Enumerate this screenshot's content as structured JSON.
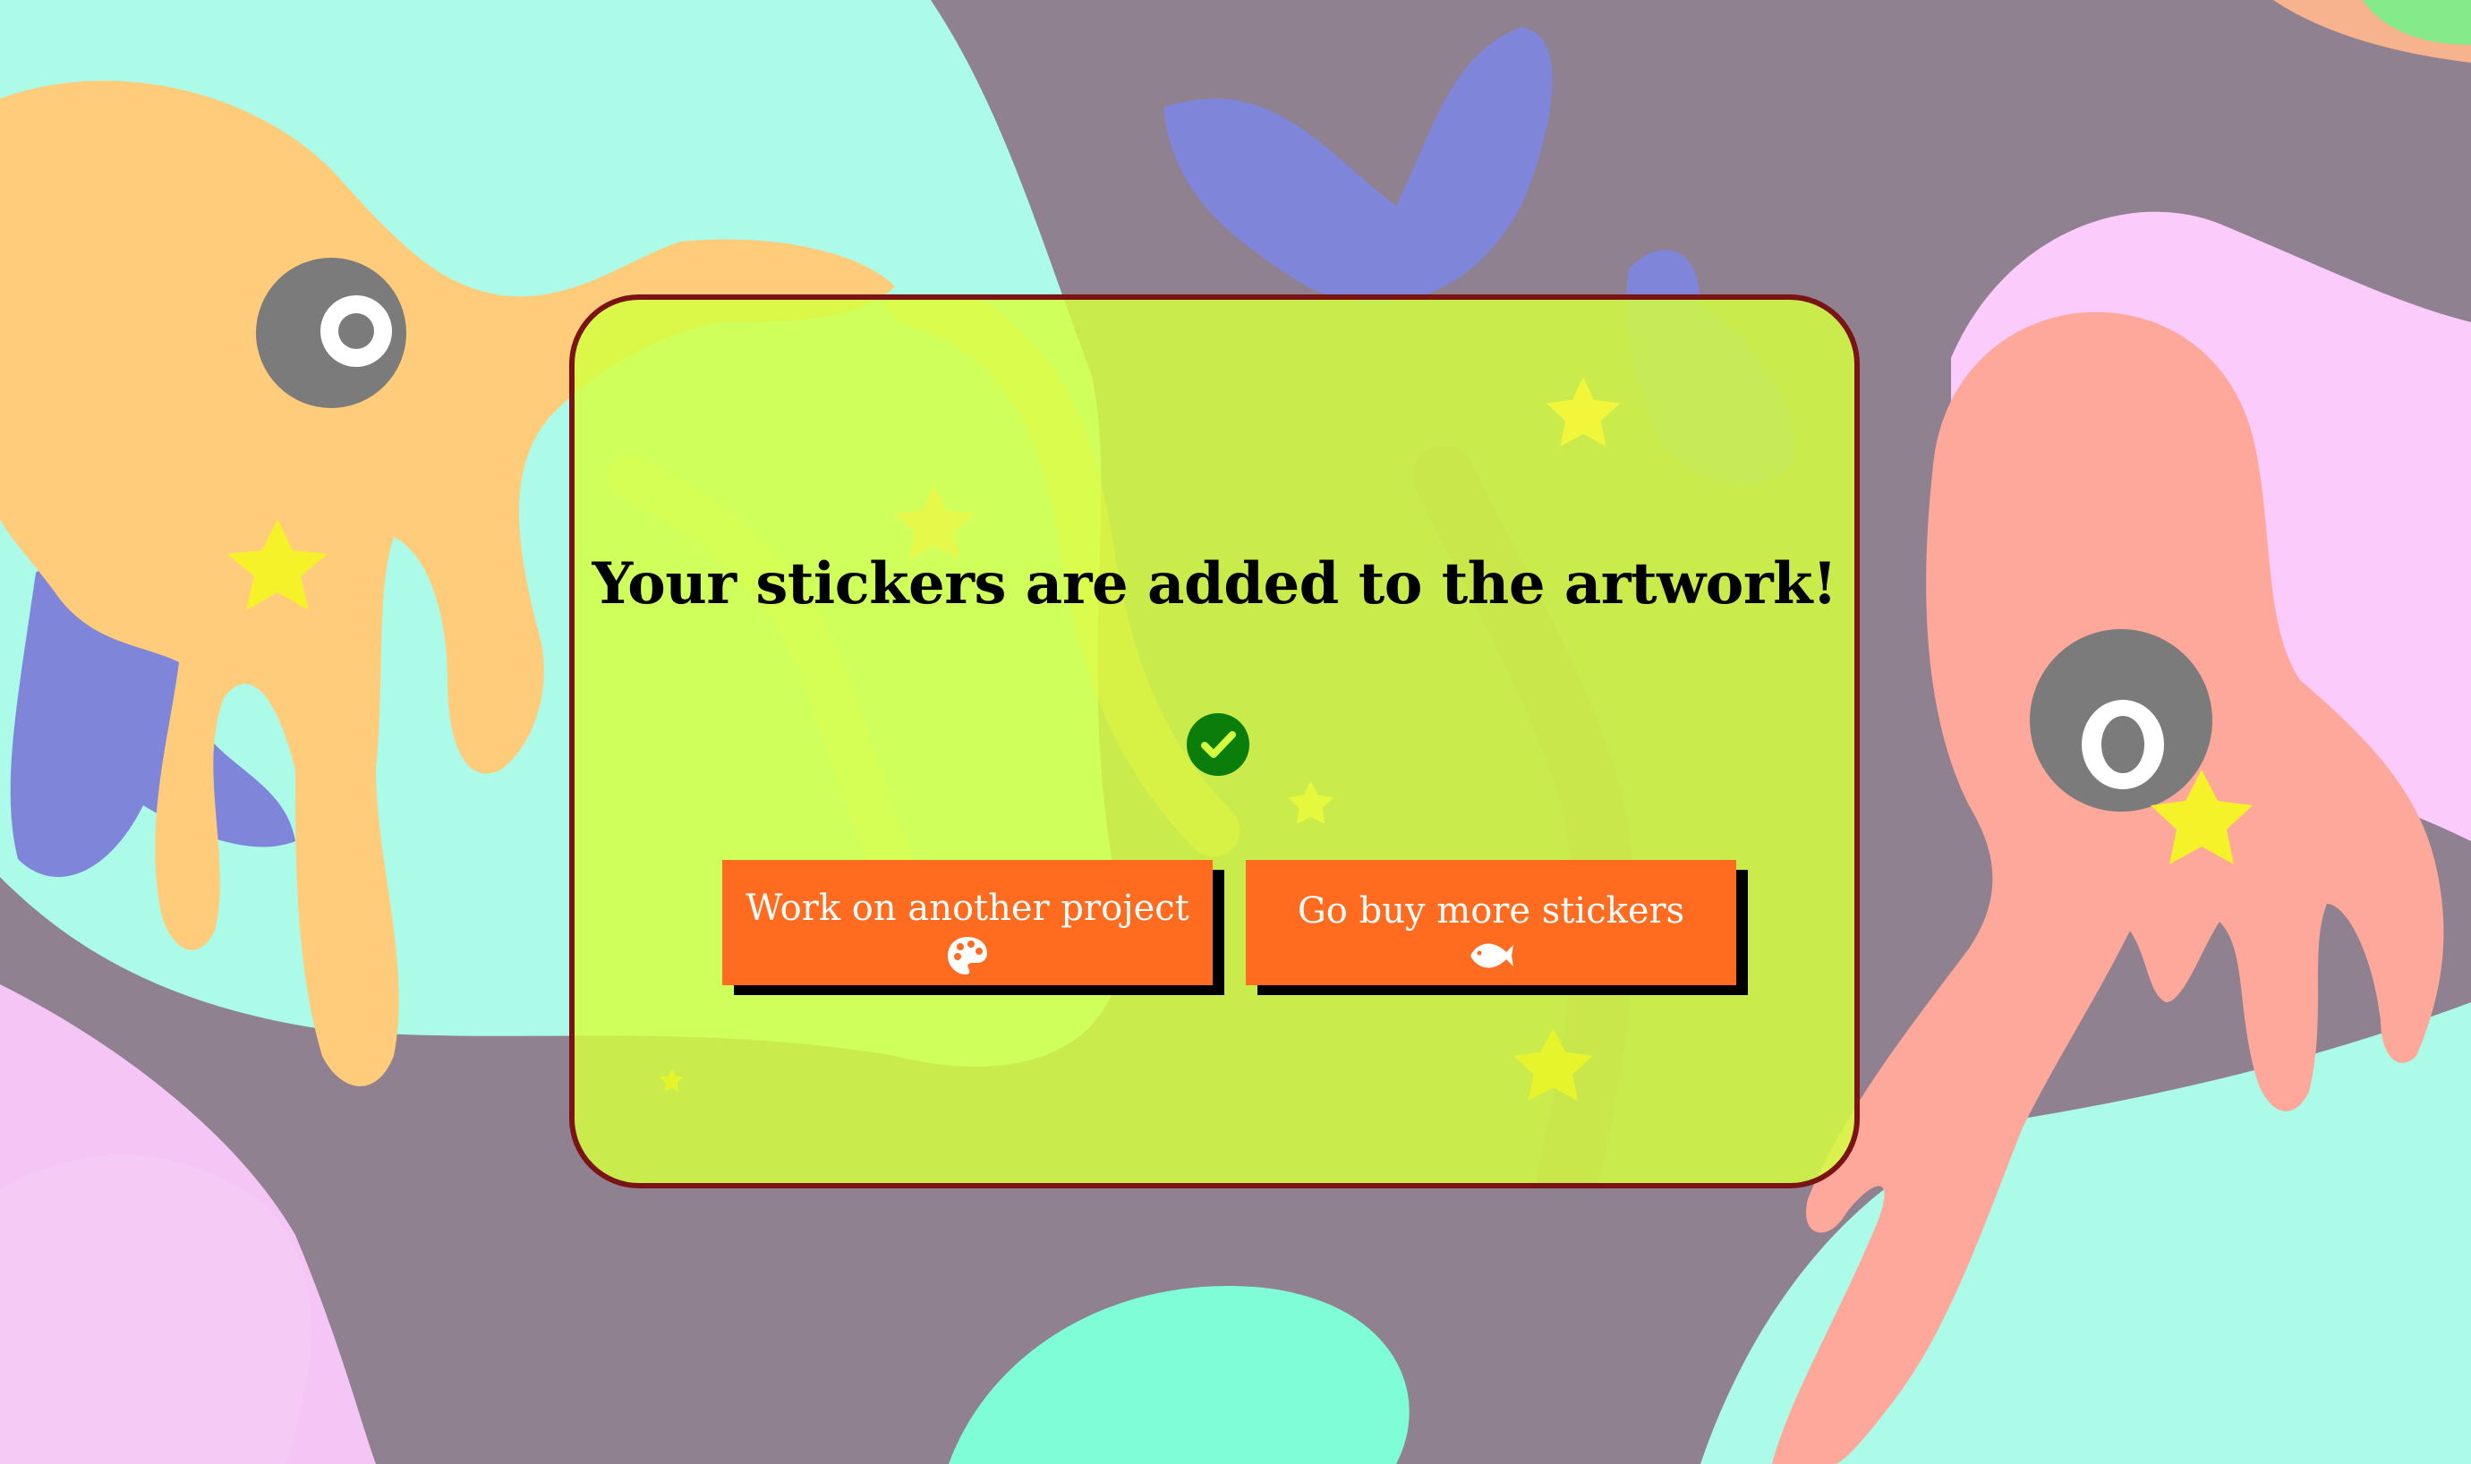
{
  "modal": {
    "title": "Your stickers are added to the artwork!",
    "status_icon": "check-circle-icon"
  },
  "actions": {
    "work_label": "Work on another project",
    "work_icon": "palette-icon",
    "buy_label": "Go buy more stickers",
    "buy_icon": "fish-icon"
  },
  "colors": {
    "modal_background": "#d4ff3e",
    "modal_border": "#7a1414",
    "button_background": "#ff6b1f",
    "button_shadow": "#000000",
    "success_green": "#0a7d0a",
    "star_yellow": "#f5f22a"
  }
}
